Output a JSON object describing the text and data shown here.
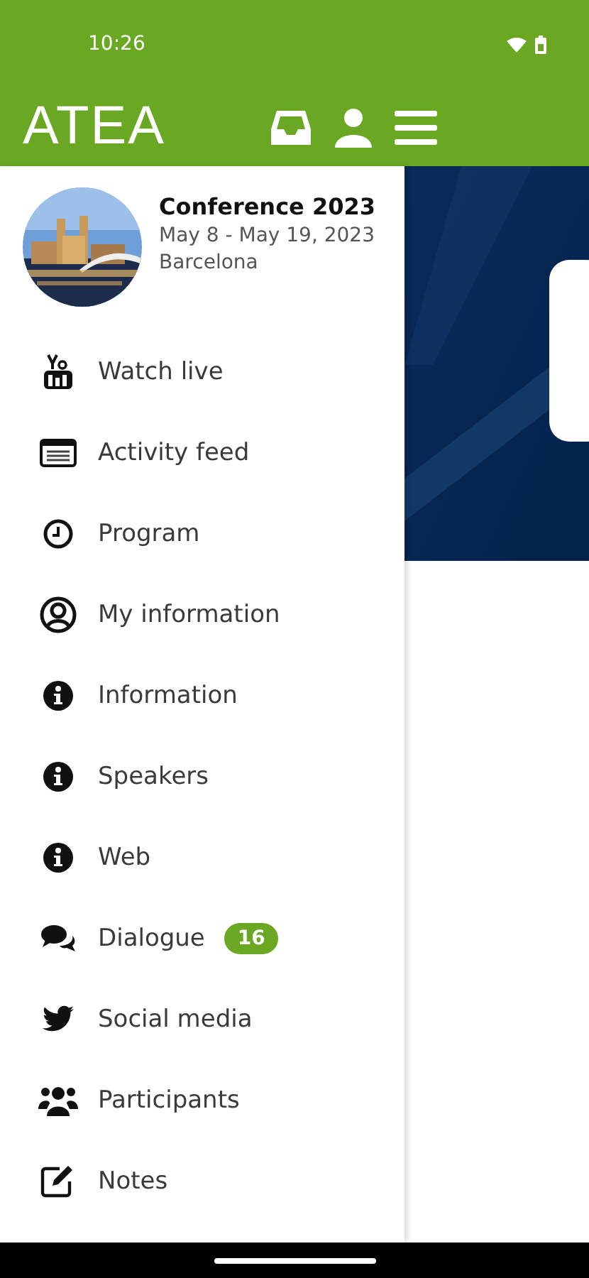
{
  "status_bar": {
    "time": "10:26"
  },
  "app_bar": {
    "logo": "ATEA"
  },
  "event": {
    "title": "Conference 2023",
    "dates": "May 8 - May 19, 2023",
    "city": "Barcelona"
  },
  "menu": [
    {
      "label": "Watch live"
    },
    {
      "label": "Activity feed"
    },
    {
      "label": "Program"
    },
    {
      "label": "My information"
    },
    {
      "label": "Information"
    },
    {
      "label": "Speakers"
    },
    {
      "label": "Web"
    },
    {
      "label": "Dialogue",
      "badge": "16"
    },
    {
      "label": "Social media"
    },
    {
      "label": "Participants"
    },
    {
      "label": "Notes"
    }
  ]
}
